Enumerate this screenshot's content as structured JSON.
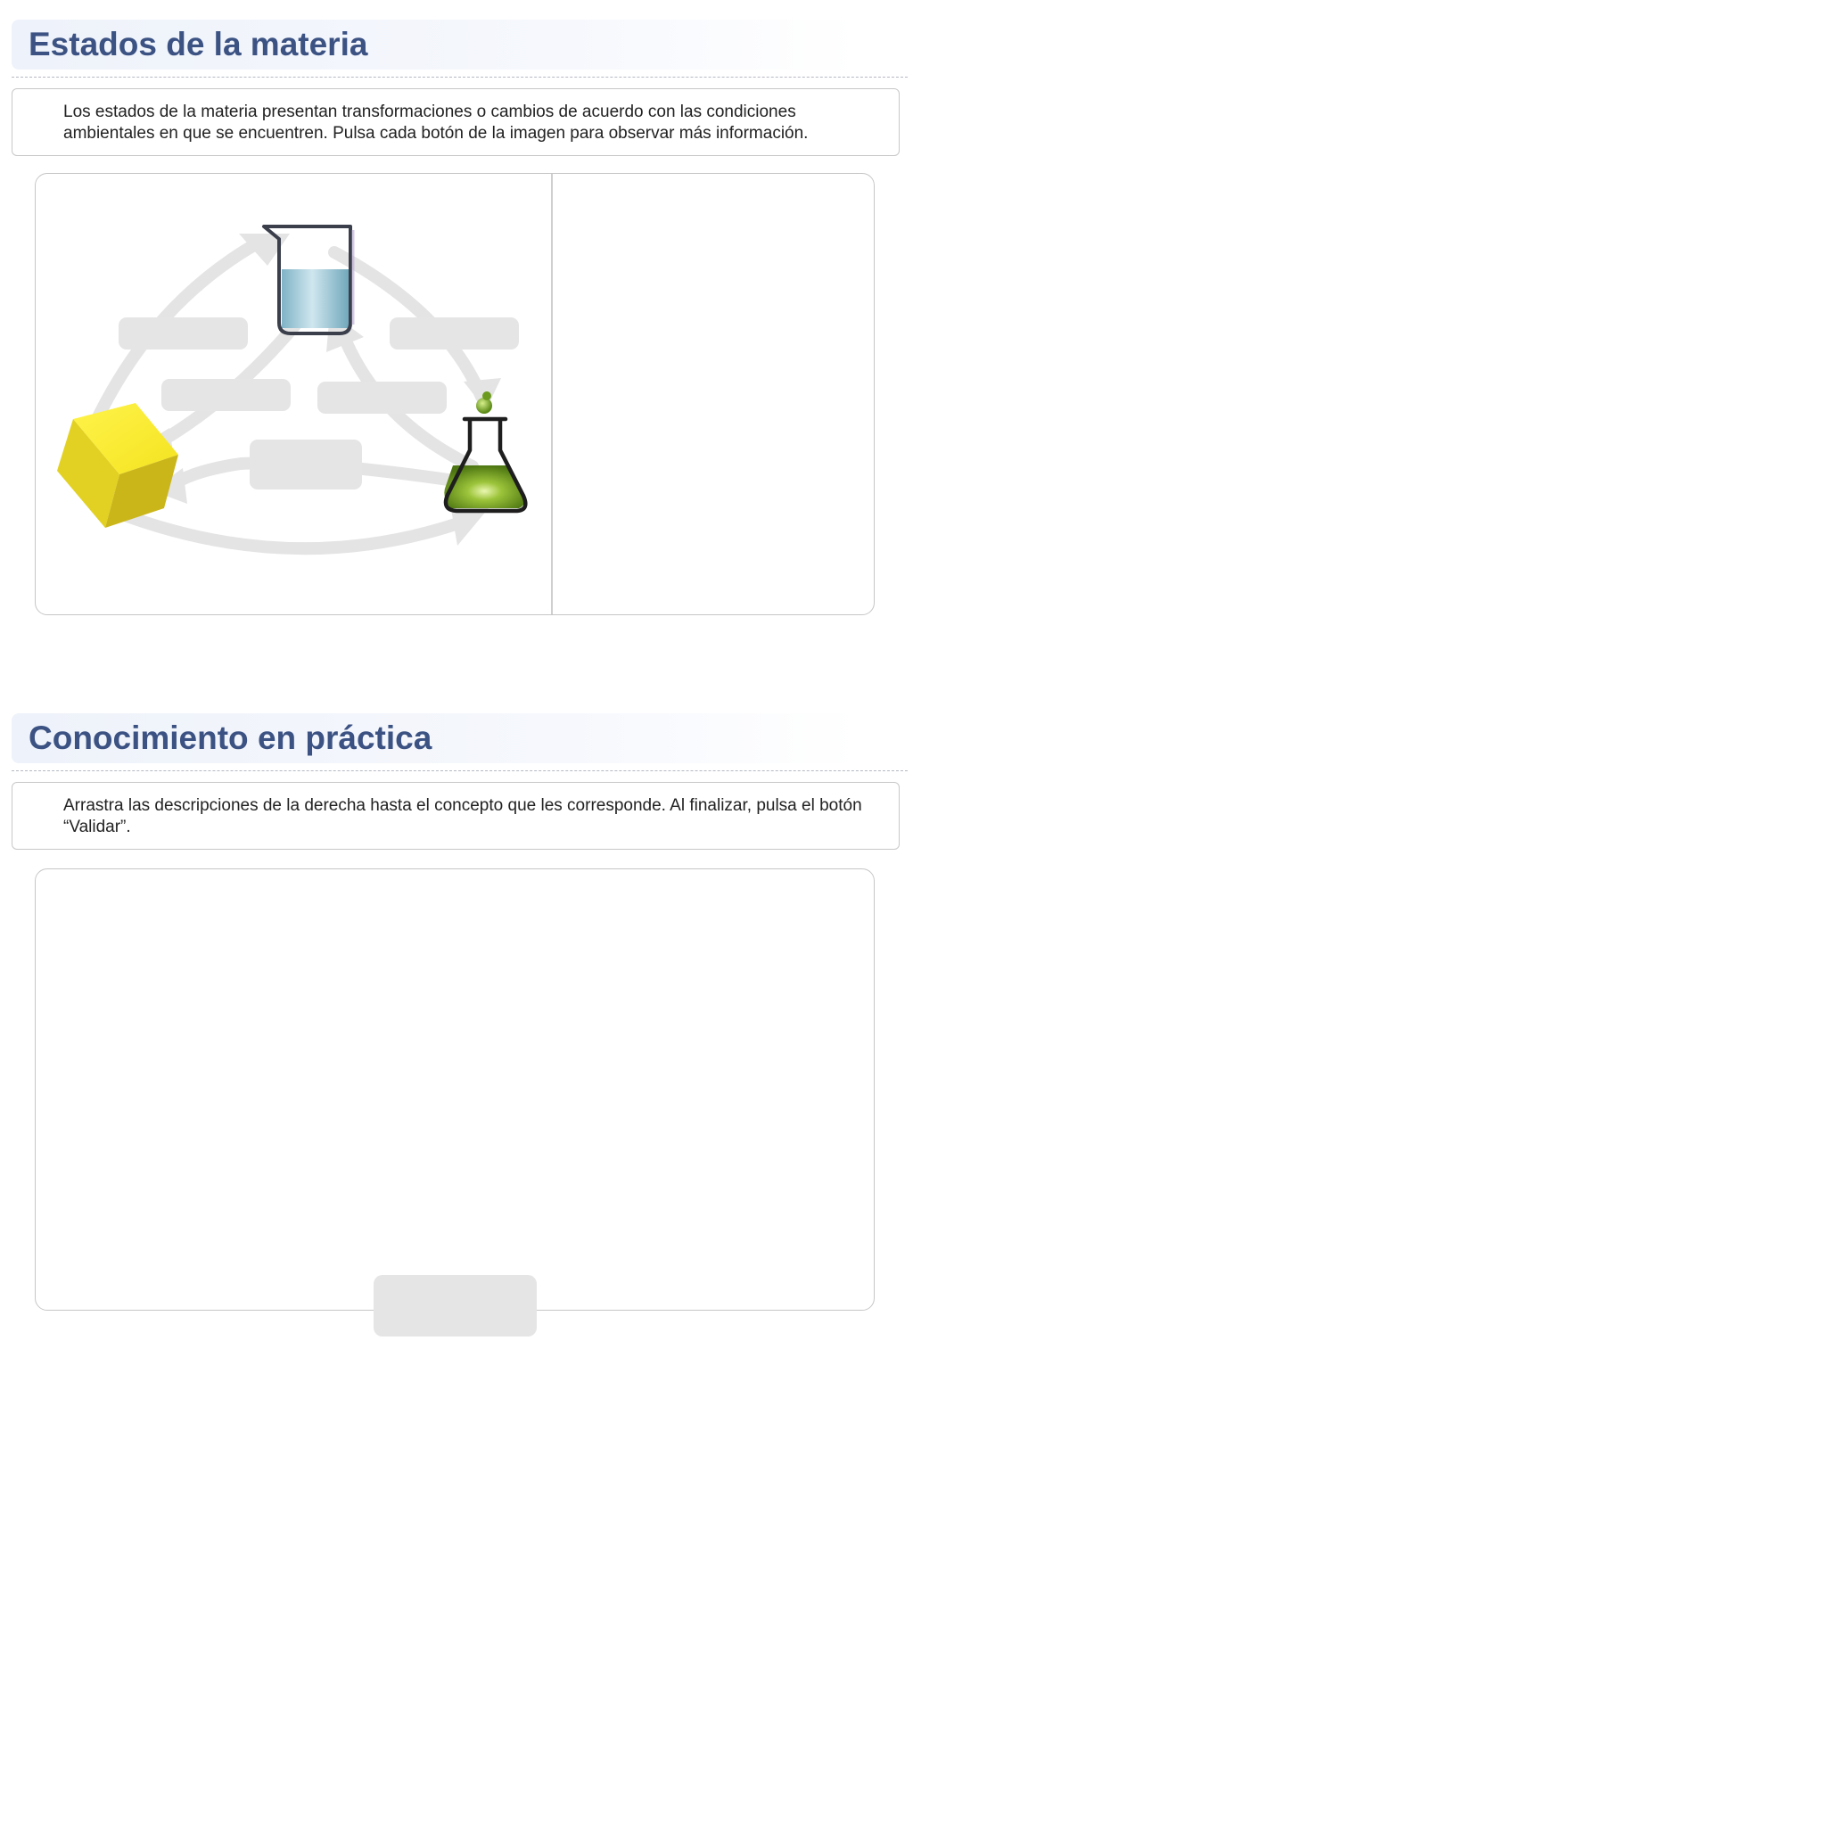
{
  "section1": {
    "title": "Estados de la materia",
    "instruction": "Los estados de la materia presentan transformaciones o cambios de acuerdo con las condiciones ambientales en que se encuentren. Pulsa cada botón de la imagen para observar más información.",
    "diagram": {
      "states": [
        {
          "name": "liquid-beaker-icon"
        },
        {
          "name": "solid-cube-icon"
        },
        {
          "name": "gas-flask-icon"
        }
      ],
      "buttons": [
        {
          "label": ""
        },
        {
          "label": ""
        },
        {
          "label": ""
        },
        {
          "label": ""
        },
        {
          "label": ""
        }
      ]
    },
    "info_panel_text": ""
  },
  "section2": {
    "title": "Conocimiento en práctica",
    "instruction": "Arrastra las descripciones de la derecha hasta el concepto que les corresponde. Al finalizar, pulsa el botón “Validar”.",
    "validate_label": ""
  },
  "colors": {
    "title": "#3b5283",
    "slot": "#e5e5e5",
    "arrow": "#e4e4e4",
    "cube": "#f0e020",
    "liquid": "#9fcbd8",
    "flask_liquid": "#7aa22a"
  }
}
